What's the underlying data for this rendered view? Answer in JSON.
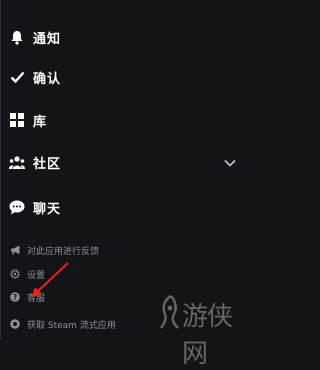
{
  "menu": {
    "notifications": {
      "label": "通知",
      "icon": "bell-icon"
    },
    "confirm": {
      "label": "确认",
      "icon": "check-icon"
    },
    "library": {
      "label": "库",
      "icon": "grid-icon"
    },
    "community": {
      "label": "社区",
      "icon": "community-icon",
      "chevron": "chevron-down-icon"
    },
    "chat": {
      "label": "聊天",
      "icon": "chat-bubble-icon"
    }
  },
  "secondary": {
    "feedback": {
      "label": "对此应用进行反馈",
      "icon": "megaphone-icon"
    },
    "settings": {
      "label": "设置",
      "icon": "gear-icon"
    },
    "help": {
      "label": "客服",
      "icon": "question-icon"
    },
    "streaming": {
      "label": "获取 Steam 流式应用",
      "icon": "steam-link-icon"
    }
  },
  "watermark": {
    "text": "游侠网"
  },
  "colors": {
    "background": "#121418",
    "primary_text": "#ffffff",
    "secondary_text": "#8d9098",
    "arrow": "#e0261b"
  }
}
